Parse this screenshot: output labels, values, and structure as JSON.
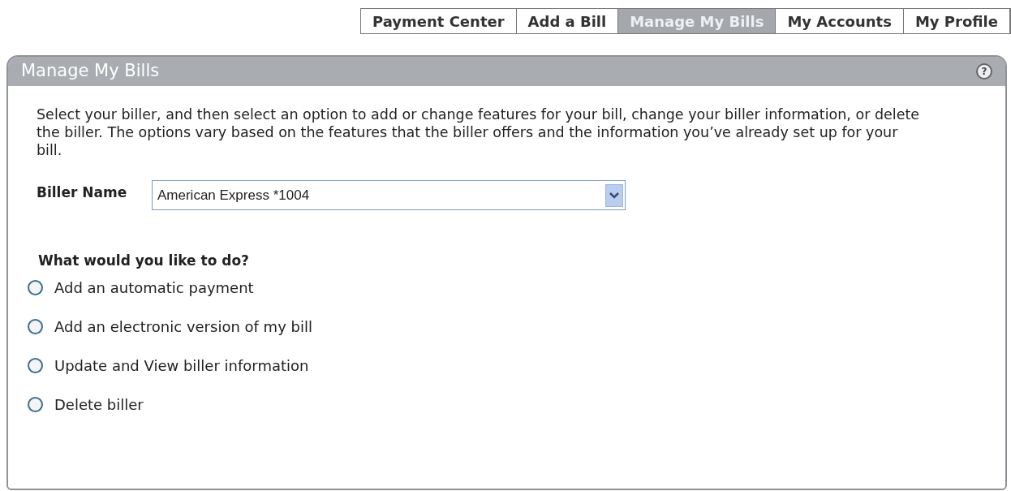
{
  "tabs": [
    {
      "label": "Payment Center",
      "selected": false
    },
    {
      "label": "Add a Bill",
      "selected": false
    },
    {
      "label": "Manage My Bills",
      "selected": true
    },
    {
      "label": "My Accounts",
      "selected": false
    },
    {
      "label": "My Profile",
      "selected": false
    }
  ],
  "panel": {
    "title": "Manage My Bills",
    "help": "?",
    "intro": "Select your biller, and then select an option to add or change features for your bill, change your biller information, or delete the biller. The options vary based on the features that the biller offers and the information you’ve already set up for your bill.",
    "biller_field": {
      "label": "Biller Name",
      "value": "American Express *1004"
    },
    "question": "What would you like to do?",
    "options": [
      {
        "label": "Add an automatic payment",
        "selected": false
      },
      {
        "label": "Add an electronic version of my bill",
        "selected": false
      },
      {
        "label": "Update and View biller information",
        "selected": false
      },
      {
        "label": "Delete biller",
        "selected": false
      }
    ]
  }
}
